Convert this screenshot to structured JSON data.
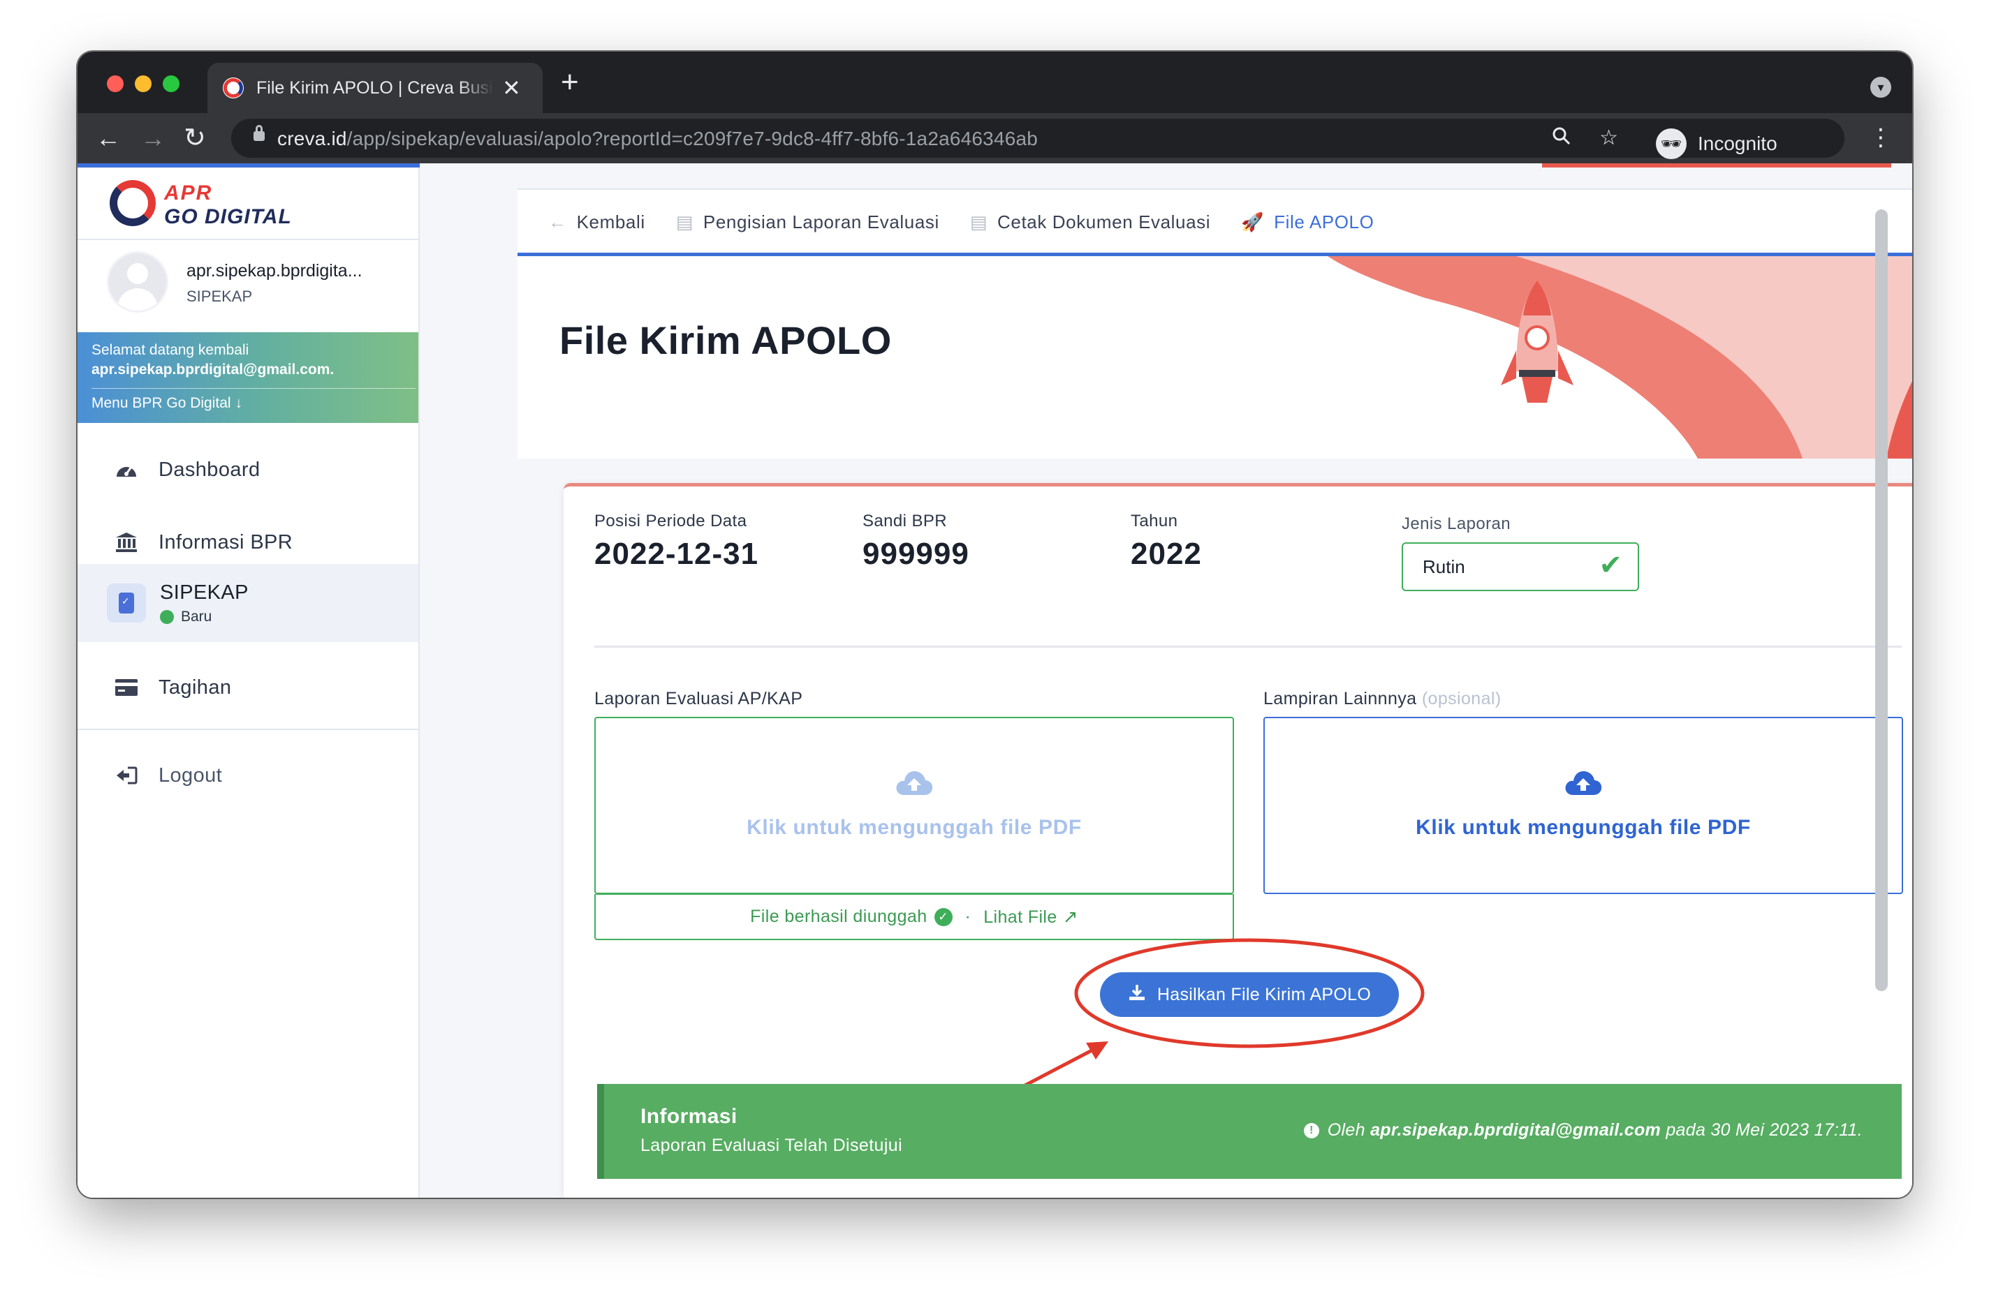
{
  "browser": {
    "tab_title": "File Kirim APOLO | Creva Business",
    "tab_close": "✕",
    "new_tab": "+",
    "url_host": "creva.id",
    "url_path": "/app/sipekap/evaluasi/apolo?reportId=c209f7e7-9dc8-4ff7-8bf6-1a2a646346ab",
    "incognito_label": "Incognito"
  },
  "sidebar": {
    "logo_line1": "APR",
    "logo_line2": "GO DIGITAL",
    "user_name": "apr.sipekap.bprdigita...",
    "user_role": "SIPEKAP",
    "welcome_line1": "Selamat datang kembali",
    "welcome_email": "apr.sipekap.bprdigital@gmail.com.",
    "welcome_menu": "Menu BPR Go Digital",
    "welcome_menu_icon": "arrow-down-icon",
    "items": [
      {
        "label": "Dashboard",
        "icon": "gauge-icon"
      },
      {
        "label": "Informasi BPR",
        "icon": "bank-icon"
      },
      {
        "label": "SIPEKAP",
        "icon": "clipboard-check-icon",
        "badge": "Baru"
      },
      {
        "label": "Tagihan",
        "icon": "credit-card-icon"
      },
      {
        "label": "Logout",
        "icon": "sign-out-icon"
      }
    ]
  },
  "breadcrumb": {
    "items": [
      {
        "label": "Kembali",
        "icon": "arrow-left-icon"
      },
      {
        "label": "Pengisian Laporan Evaluasi",
        "icon": "file-icon"
      },
      {
        "label": "Cetak Dokumen Evaluasi",
        "icon": "file-icon"
      },
      {
        "label": "File APOLO",
        "icon": "rocket-icon",
        "active": true
      }
    ]
  },
  "page": {
    "title": "File Kirim APOLO"
  },
  "report": {
    "periode_label": "Posisi Periode Data",
    "periode_value": "2022-12-31",
    "sandi_label": "Sandi BPR",
    "sandi_value": "999999",
    "tahun_label": "Tahun",
    "tahun_value": "2022",
    "jenis_label": "Jenis Laporan",
    "jenis_value": "Rutin"
  },
  "uploads": {
    "left_label": "Laporan Evaluasi AP/KAP",
    "left_text": "Klik untuk mengunggah file PDF",
    "left_status": "File berhasil diunggah",
    "left_separator": "·",
    "left_link": "Lihat File",
    "right_label": "Lampiran Lainnnya",
    "right_optional": "(opsional)",
    "right_text": "Klik untuk mengunggah file PDF"
  },
  "actions": {
    "generate_label": "Hasilkan File Kirim APOLO"
  },
  "info": {
    "title": "Informasi",
    "subtitle": "Laporan Evaluasi Telah Disetujui",
    "by_prefix": "Oleh",
    "by_email": "apr.sipekap.bprdigital@gmail.com",
    "by_suffix": "pada 30 Mei 2023 17:11."
  },
  "colors": {
    "primary": "#3b74d6",
    "success": "#57ad62",
    "annotation": "#e0392b"
  }
}
